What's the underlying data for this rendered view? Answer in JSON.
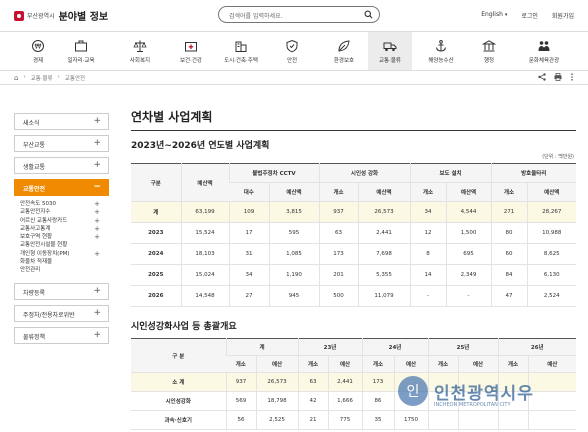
{
  "header": {
    "org": "부산광역시",
    "title": "분야별 정보",
    "search_placeholder": "검색어를 입력하세요.",
    "lang": "English",
    "login": "로그인",
    "signup": "회원가입"
  },
  "categories": [
    {
      "label": "경제",
      "icon": "coin-icon"
    },
    {
      "label": "일자리·교육",
      "icon": "briefcase-icon"
    },
    {
      "label": "사회복지",
      "icon": "scale-icon"
    },
    {
      "label": "보건·건강",
      "icon": "medical-kit-icon"
    },
    {
      "label": "도시·건축·주택",
      "icon": "building-icon"
    },
    {
      "label": "안전",
      "icon": "shield-icon"
    },
    {
      "label": "환경보호",
      "icon": "leaf-icon"
    },
    {
      "label": "교통·물류",
      "icon": "truck-icon"
    },
    {
      "label": "해양농수산",
      "icon": "anchor-icon"
    },
    {
      "label": "행정",
      "icon": "government-icon"
    },
    {
      "label": "문화체육관광",
      "icon": "people-icon"
    }
  ],
  "breadcrumb": [
    "교통·물류",
    "교통안전"
  ],
  "sidebar": {
    "items": [
      {
        "label": "새소식",
        "active": false
      },
      {
        "label": "부산교통",
        "active": false
      },
      {
        "label": "생활교통",
        "active": false
      },
      {
        "label": "교통안전",
        "active": true
      }
    ],
    "sub_items": [
      {
        "label": "안전속도 5030",
        "plus": true
      },
      {
        "label": "교통안전지수",
        "plus": true
      },
      {
        "label": "어르신 교통사랑카드",
        "plus": true
      },
      {
        "label": "교통사고통계",
        "plus": true
      },
      {
        "label": "보호구역 현황",
        "plus": true
      },
      {
        "label": "교통안전시설물 현황",
        "plus": false
      },
      {
        "label": "개인형 이동장치(PM)",
        "plus": true
      },
      {
        "label": "화물차 적재물",
        "plus": false
      },
      {
        "label": "안전관리",
        "plus": false
      }
    ],
    "items_after": [
      {
        "label": "차량등록"
      },
      {
        "label": "주정차/전용차로위반"
      },
      {
        "label": "물류정책"
      }
    ]
  },
  "main": {
    "page_title": "연차별 사업계획",
    "section1_title": "2023년~2026년 연도별 사업계획",
    "unit_note": "(단위 : 백만원)",
    "section2_title": "시인성강화사업 등 총괄개요"
  },
  "table1": {
    "h_year": "구분",
    "h_budget": "예산액",
    "groups": [
      "불법주정차 CCTV",
      "시인성 강화",
      "보도 설치",
      "방호울타리"
    ],
    "sub_headers": [
      [
        "대수",
        "예산액"
      ],
      [
        "개소",
        "예산액"
      ],
      [
        "개소",
        "예산액"
      ],
      [
        "개소",
        "예산액"
      ]
    ],
    "rows": [
      {
        "label": "계",
        "cells": [
          "63,199",
          "109",
          "3,815",
          "937",
          "26,573",
          "34",
          "4,544",
          "271",
          "28,267"
        ],
        "sum": true
      },
      {
        "label": "2023",
        "cells": [
          "15,524",
          "17",
          "595",
          "63",
          "2,441",
          "12",
          "1,500",
          "80",
          "10,988"
        ]
      },
      {
        "label": "2024",
        "cells": [
          "18,103",
          "31",
          "1,085",
          "173",
          "7,698",
          "8",
          "695",
          "60",
          "8,625"
        ]
      },
      {
        "label": "2025",
        "cells": [
          "15,024",
          "34",
          "1,190",
          "201",
          "5,355",
          "14",
          "2,349",
          "84",
          "6,130"
        ]
      },
      {
        "label": "2026",
        "cells": [
          "14,548",
          "27",
          "945",
          "500",
          "11,079",
          "-",
          "-",
          "47",
          "2,524"
        ]
      }
    ]
  },
  "table2": {
    "h_cat": "구 분",
    "groups": [
      "계",
      "23년",
      "24년",
      "25년",
      "26년"
    ],
    "sub_headers": [
      "개소",
      "예산",
      "개소",
      "예산",
      "개소",
      "예산",
      "개소",
      "예산",
      "개소",
      "예산"
    ],
    "rows": [
      {
        "label": "소 계",
        "cells": [
          "937",
          "26,573",
          "63",
          "2,441",
          "173",
          "",
          "",
          "",
          "",
          ""
        ],
        "sum": true
      },
      {
        "label": "시인성강화",
        "cells": [
          "569",
          "18,798",
          "42",
          "1,666",
          "86",
          "",
          "",
          "",
          "",
          ""
        ]
      },
      {
        "label": "과속·신호기",
        "cells": [
          "56",
          "2,525",
          "21",
          "775",
          "35",
          "1750",
          "",
          "",
          "",
          ""
        ]
      }
    ]
  },
  "watermark": {
    "text": "인천광역시우",
    "sub": "INCHEON METROPOLITAN CITY",
    "letter": "인"
  },
  "colors": {
    "accent": "#f08a00",
    "brand": "#c8102e",
    "sum_row": "#fbf8e4"
  }
}
